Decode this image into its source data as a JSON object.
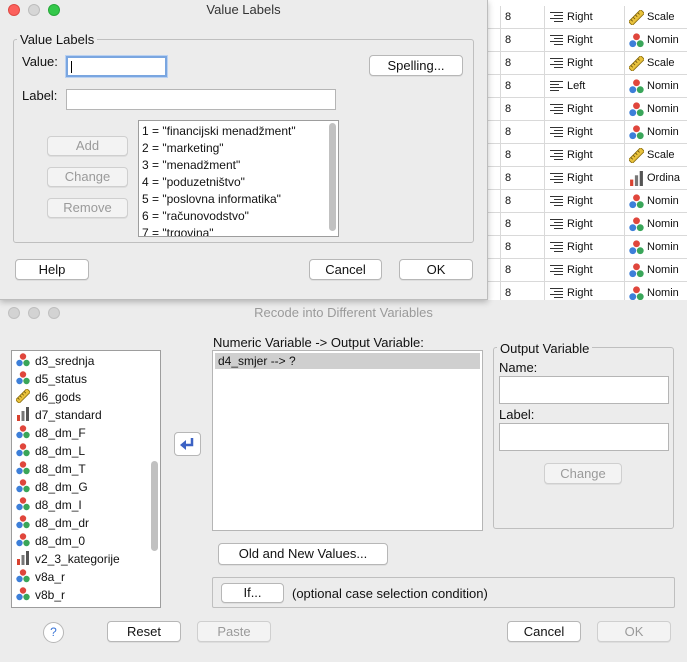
{
  "data_grid": {
    "rows": [
      {
        "width": "8",
        "align": "Right",
        "measure": "Scale",
        "measure_icon": "ruler-icon"
      },
      {
        "width": "8",
        "align": "Right",
        "measure": "Nomin",
        "measure_icon": "nominal-icon"
      },
      {
        "width": "8",
        "align": "Right",
        "measure": "Scale",
        "measure_icon": "ruler-icon"
      },
      {
        "width": "8",
        "align": "Left",
        "measure": "Nomin",
        "measure_icon": "nominal-icon"
      },
      {
        "width": "8",
        "align": "Right",
        "measure": "Nomin",
        "measure_icon": "nominal-icon"
      },
      {
        "width": "8",
        "align": "Right",
        "measure": "Nomin",
        "measure_icon": "nominal-icon"
      },
      {
        "width": "8",
        "align": "Right",
        "measure": "Scale",
        "measure_icon": "ruler-icon"
      },
      {
        "width": "8",
        "align": "Right",
        "measure": "Ordina",
        "measure_icon": "ordinal-icon"
      },
      {
        "width": "8",
        "align": "Right",
        "measure": "Nomin",
        "measure_icon": "nominal-icon"
      },
      {
        "width": "8",
        "align": "Right",
        "measure": "Nomin",
        "measure_icon": "nominal-icon"
      },
      {
        "width": "8",
        "align": "Right",
        "measure": "Nomin",
        "measure_icon": "nominal-icon"
      },
      {
        "width": "8",
        "align": "Right",
        "measure": "Nomin",
        "measure_icon": "nominal-icon"
      },
      {
        "width": "8",
        "align": "Right",
        "measure": "Nomin",
        "measure_icon": "nominal-icon"
      }
    ]
  },
  "value_labels_dialog": {
    "title": "Value Labels",
    "group_title": "Value Labels",
    "value_label": "Value:",
    "value_input": "",
    "label_label": "Label:",
    "label_input": "",
    "spelling_button": "Spelling...",
    "add_button": "Add",
    "change_button": "Change",
    "remove_button": "Remove",
    "labels_list": [
      "1 = \"financijski menadžment\"",
      "2 = \"marketing\"",
      "3 = \"menadžment\"",
      "4 = \"poduzetništvo\"",
      "5 = \"poslovna informatika\"",
      "6 = \"računovodstvo\"",
      "7 = \"trgovina\""
    ],
    "help_button": "Help",
    "cancel_button": "Cancel",
    "ok_button": "OK"
  },
  "recode_dialog": {
    "title": "Recode into Different Variables",
    "variables": [
      {
        "name": "d3_srednja",
        "icon": "nominal-icon"
      },
      {
        "name": "d5_status",
        "icon": "nominal-icon"
      },
      {
        "name": "d6_gods",
        "icon": "ruler-icon"
      },
      {
        "name": "d7_standard",
        "icon": "ordinal-icon"
      },
      {
        "name": "d8_dm_F",
        "icon": "nominal-icon"
      },
      {
        "name": "d8_dm_L",
        "icon": "nominal-icon"
      },
      {
        "name": "d8_dm_T",
        "icon": "nominal-icon"
      },
      {
        "name": "d8_dm_G",
        "icon": "nominal-icon"
      },
      {
        "name": "d8_dm_I",
        "icon": "nominal-icon"
      },
      {
        "name": "d8_dm_dr",
        "icon": "nominal-icon"
      },
      {
        "name": "d8_dm_0",
        "icon": "nominal-icon"
      },
      {
        "name": "v2_3_kategorije",
        "icon": "ordinal-icon"
      },
      {
        "name": "v8a_r",
        "icon": "nominal-icon"
      },
      {
        "name": "v8b_r",
        "icon": "nominal-icon"
      }
    ],
    "numeric_output_label": "Numeric Variable -> Output Variable:",
    "mapping_items": [
      "d4_smjer --> ?"
    ],
    "output_group_title": "Output Variable",
    "name_label": "Name:",
    "name_input": "",
    "label_label": "Label:",
    "label_input": "",
    "change_button": "Change",
    "old_new_button": "Old and New Values...",
    "if_button": "If...",
    "if_caption": "(optional case selection condition)",
    "reset_button": "Reset",
    "paste_button": "Paste",
    "cancel_button": "Cancel",
    "ok_button": "OK",
    "help_glyph": "?"
  },
  "colors": {
    "focus_ring": "#7aa6e0",
    "nominal_red": "#e0463c",
    "nominal_blue": "#3d7fd9",
    "nominal_green": "#3aa65a",
    "ordinal_red": "#d8412f",
    "ruler_yellow": "#e9c23c"
  }
}
